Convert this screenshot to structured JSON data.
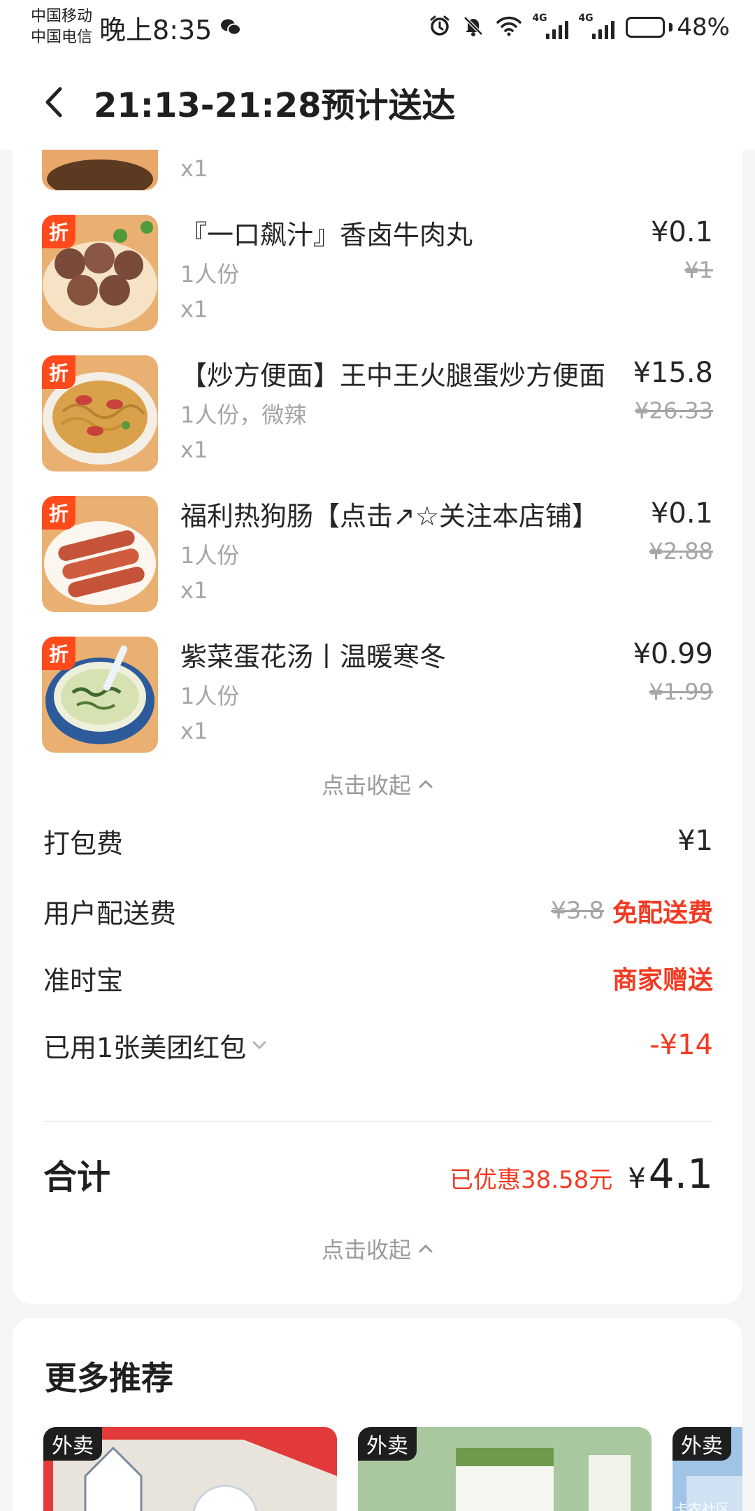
{
  "status_bar": {
    "carrier_1": "中国移动",
    "carrier_2": "中国电信",
    "time": "晚上8:35",
    "network_1": "4G",
    "network_2": "4G",
    "battery": "48%",
    "battery_level": 0.48
  },
  "header": {
    "title": "21:13-21:28预计送达",
    "back_icon": "chevron-left-icon"
  },
  "order": {
    "discount_badge": "折",
    "items": [
      {
        "name": "",
        "spec": "",
        "qty": "x1",
        "price": "",
        "original_price": "",
        "discounted": false
      },
      {
        "name": "『一口飙汁』香卤牛肉丸",
        "spec": "1人份",
        "qty": "x1",
        "price": "¥0.1",
        "original_price": "¥1",
        "discounted": true
      },
      {
        "name": "【炒方便面】王中王火腿蛋炒方便面",
        "spec": "1人份，微辣",
        "qty": "x1",
        "price": "¥15.8",
        "original_price": "¥26.33",
        "discounted": true
      },
      {
        "name": "福利热狗肠【点击↗☆关注本店铺】",
        "spec": "1人份",
        "qty": "x1",
        "price": "¥0.1",
        "original_price": "¥2.88",
        "discounted": true
      },
      {
        "name": "紫菜蛋花汤丨温暖寒冬",
        "spec": "1人份",
        "qty": "x1",
        "price": "¥0.99",
        "original_price": "¥1.99",
        "discounted": true
      }
    ],
    "collapse_label": "点击收起",
    "fees": {
      "packing_label": "打包费",
      "packing_value": "¥1",
      "delivery_label": "用户配送费",
      "delivery_original": "¥3.8",
      "delivery_value": "免配送费",
      "ontime_label": "准时宝",
      "ontime_value": "商家赠送",
      "redpacket_label": "已用1张美团红包",
      "redpacket_value": "-¥14"
    },
    "total": {
      "label": "合计",
      "saved": "已优惠38.58元",
      "currency": "¥",
      "amount": "4.1"
    },
    "collapse_label_2": "点击收起"
  },
  "recommend": {
    "title": "更多推荐",
    "badge": "外卖",
    "watermark": "卡农社区"
  },
  "colors": {
    "accent_red": "#f23a22",
    "badge_orange": "#ff4a1c",
    "muted_text": "#a5a5a5"
  }
}
